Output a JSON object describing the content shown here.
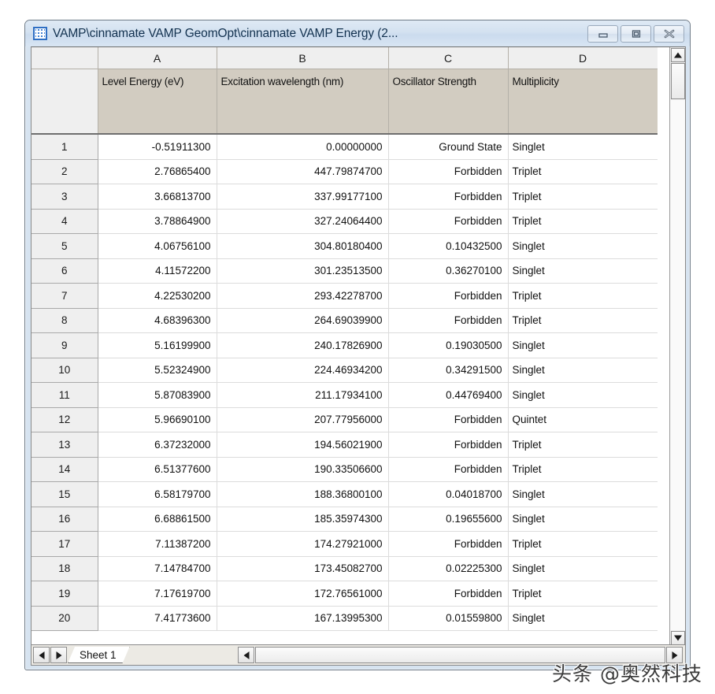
{
  "window": {
    "title": "VAMP\\cinnamate VAMP GeomOpt\\cinnamate VAMP Energy (2...",
    "app_icon": "spreadsheet-grid-icon",
    "controls": {
      "minimize": "minimize-icon",
      "restore": "restore-icon",
      "close": "close-icon"
    }
  },
  "sheet": {
    "column_letters": [
      "",
      "A",
      "B",
      "C",
      "D"
    ],
    "long_names": [
      "",
      "Level Energy (eV)",
      "Excitation wavelength (nm)",
      "Oscillator Strength",
      "Multiplicity"
    ],
    "rows": [
      {
        "n": "1",
        "a": "-0.51911300",
        "b": "0.00000000",
        "c": "Ground State",
        "d": "Singlet"
      },
      {
        "n": "2",
        "a": "2.76865400",
        "b": "447.79874700",
        "c": "Forbidden",
        "d": "Triplet"
      },
      {
        "n": "3",
        "a": "3.66813700",
        "b": "337.99177100",
        "c": "Forbidden",
        "d": "Triplet"
      },
      {
        "n": "4",
        "a": "3.78864900",
        "b": "327.24064400",
        "c": "Forbidden",
        "d": "Triplet"
      },
      {
        "n": "5",
        "a": "4.06756100",
        "b": "304.80180400",
        "c": "0.10432500",
        "d": "Singlet"
      },
      {
        "n": "6",
        "a": "4.11572200",
        "b": "301.23513500",
        "c": "0.36270100",
        "d": "Singlet"
      },
      {
        "n": "7",
        "a": "4.22530200",
        "b": "293.42278700",
        "c": "Forbidden",
        "d": "Triplet"
      },
      {
        "n": "8",
        "a": "4.68396300",
        "b": "264.69039900",
        "c": "Forbidden",
        "d": "Triplet"
      },
      {
        "n": "9",
        "a": "5.16199900",
        "b": "240.17826900",
        "c": "0.19030500",
        "d": "Singlet"
      },
      {
        "n": "10",
        "a": "5.52324900",
        "b": "224.46934200",
        "c": "0.34291500",
        "d": "Singlet"
      },
      {
        "n": "11",
        "a": "5.87083900",
        "b": "211.17934100",
        "c": "0.44769400",
        "d": "Singlet"
      },
      {
        "n": "12",
        "a": "5.96690100",
        "b": "207.77956000",
        "c": "Forbidden",
        "d": "Quintet"
      },
      {
        "n": "13",
        "a": "6.37232000",
        "b": "194.56021900",
        "c": "Forbidden",
        "d": "Triplet"
      },
      {
        "n": "14",
        "a": "6.51377600",
        "b": "190.33506600",
        "c": "Forbidden",
        "d": "Triplet"
      },
      {
        "n": "15",
        "a": "6.58179700",
        "b": "188.36800100",
        "c": "0.04018700",
        "d": "Singlet"
      },
      {
        "n": "16",
        "a": "6.68861500",
        "b": "185.35974300",
        "c": "0.19655600",
        "d": "Singlet"
      },
      {
        "n": "17",
        "a": "7.11387200",
        "b": "174.27921000",
        "c": "Forbidden",
        "d": "Triplet"
      },
      {
        "n": "18",
        "a": "7.14784700",
        "b": "173.45082700",
        "c": "0.02225300",
        "d": "Singlet"
      },
      {
        "n": "19",
        "a": "7.17619700",
        "b": "172.76561000",
        "c": "Forbidden",
        "d": "Triplet"
      },
      {
        "n": "20",
        "a": "7.41773600",
        "b": "167.13995300",
        "c": "0.01559800",
        "d": "Singlet"
      }
    ]
  },
  "bottom": {
    "tab_label": "Sheet 1",
    "nav_prev": "left-arrow-icon",
    "nav_next": "right-arrow-icon"
  },
  "watermark": {
    "text": "头条 @奥然科技"
  }
}
